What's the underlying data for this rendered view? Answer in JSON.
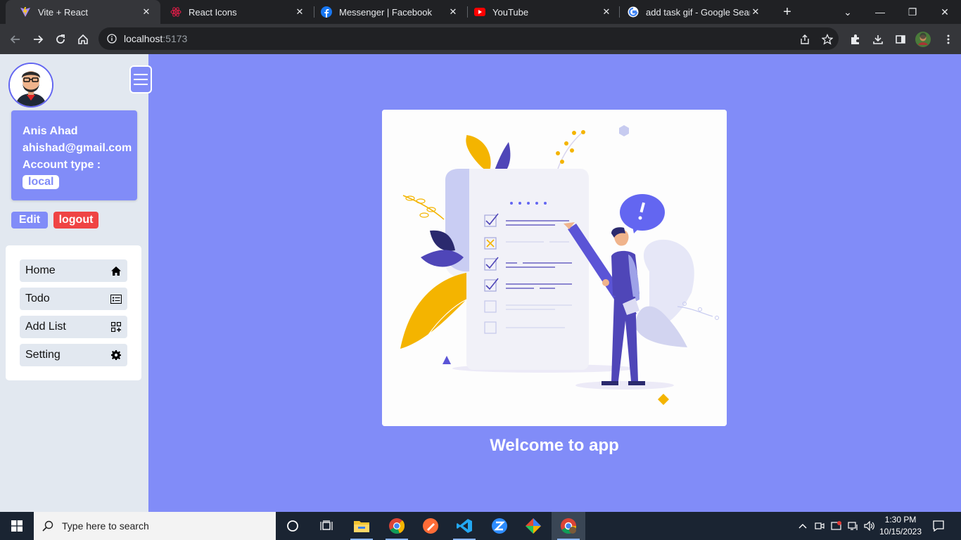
{
  "browser": {
    "tabs": [
      {
        "title": "Vite + React",
        "icon": "vite-icon"
      },
      {
        "title": "React Icons",
        "icon": "react-icon"
      },
      {
        "title": "Messenger | Facebook",
        "icon": "facebook-icon"
      },
      {
        "title": "YouTube",
        "icon": "youtube-icon"
      },
      {
        "title": "add task gif - Google Search",
        "icon": "google-icon"
      }
    ],
    "url_host": "localhost",
    "url_port": ":5173"
  },
  "sidebar": {
    "user_name": "Anis Ahad",
    "email": "ahishad@gmail.com",
    "account_type_label": "Account type :",
    "account_type": "local",
    "edit_label": "Edit",
    "logout_label": "logout",
    "menu": [
      {
        "label": "Home",
        "icon": "home-icon"
      },
      {
        "label": "Todo",
        "icon": "list-icon"
      },
      {
        "label": "Add List",
        "icon": "add-list-icon"
      },
      {
        "label": "Setting",
        "icon": "gear-icon"
      }
    ]
  },
  "main": {
    "welcome": "Welcome to app"
  },
  "taskbar": {
    "search_placeholder": "Type here to search",
    "time": "1:30 PM",
    "date": "10/15/2023"
  },
  "colors": {
    "accent": "#818cf8",
    "sidebar_bg": "#e2e8f0",
    "logout": "#ef4444"
  }
}
